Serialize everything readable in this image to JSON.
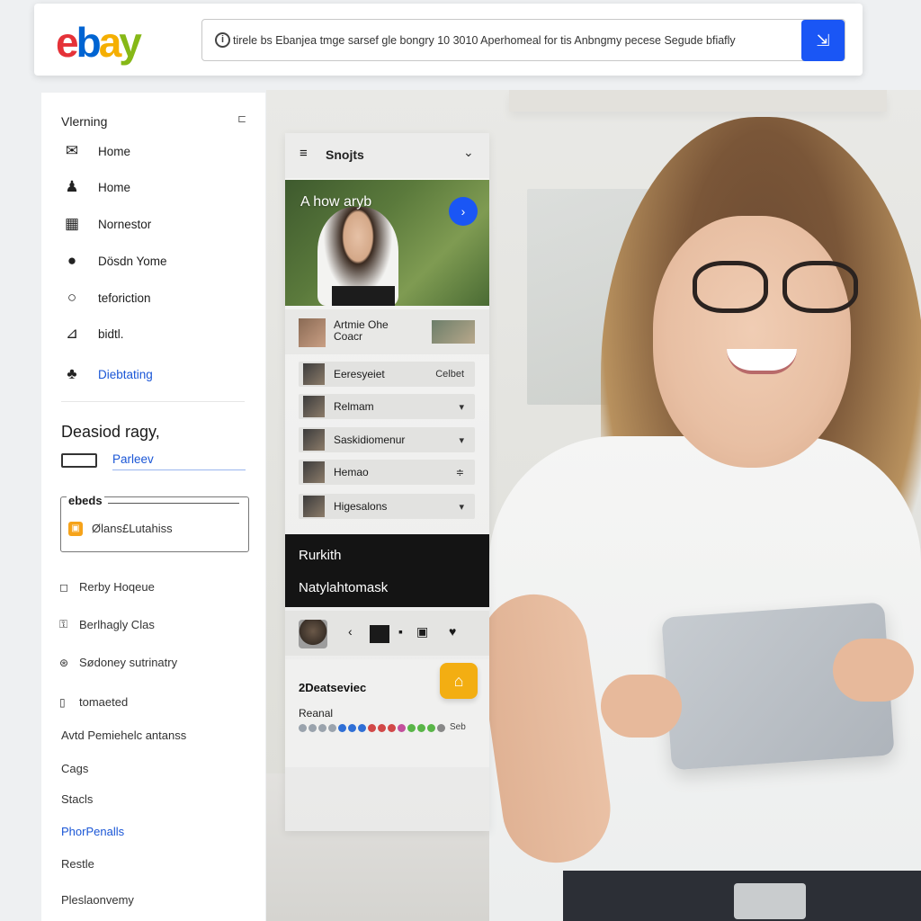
{
  "header": {
    "logo": {
      "e": "e",
      "b": "b",
      "a": "a",
      "y": "y"
    },
    "search": {
      "value": "tirele bs Ebanjea tmge sarsef gle bongry 10 3010 Aperhomeal for tis Anbngmy pecese Segude bfiafly"
    }
  },
  "sidebar": {
    "heading": "Vlerning",
    "items": [
      {
        "icon": "mail-icon",
        "label": "Home"
      },
      {
        "icon": "user-icon",
        "label": "Home"
      },
      {
        "icon": "grid-icon",
        "label": "Nornestor"
      },
      {
        "icon": "chat-icon",
        "label": "Dösdn Yome"
      },
      {
        "icon": "circle-icon",
        "label": "teforiction"
      },
      {
        "icon": "chart-icon",
        "label": "bidtl."
      },
      {
        "icon": "group-icon",
        "label": "Diebtating"
      }
    ],
    "section_title": "Deasiod ragy,",
    "section_link": "Parleev",
    "box": {
      "title": "ebeds",
      "text": "Ølans£Lutahiss"
    },
    "links": [
      {
        "label": "Rerby Hoqeue"
      },
      {
        "label": "Berlhagly Clas"
      },
      {
        "label": "Sødoney sutrinatry"
      },
      {
        "label": "tomaeted"
      }
    ],
    "plain": [
      {
        "label": "Avtd Pemiehelc antanss"
      },
      {
        "label": "Cags"
      },
      {
        "label": "Stacls"
      },
      {
        "label": "PhorPenalls"
      },
      {
        "label": "Restle"
      },
      {
        "label": "Pleslaonvemy"
      }
    ]
  },
  "panel": {
    "title": "Snojts",
    "hero_title": "A how aryb",
    "featured": {
      "line1": "Artmie Ohe",
      "line2": "Coacr"
    },
    "rows": [
      {
        "label": "Eeresyeiet",
        "right": "Celbet"
      },
      {
        "label": "Relmam",
        "right": "▾"
      },
      {
        "label": "Saskidiomenur",
        "right": "▾"
      },
      {
        "label": "Hemao",
        "right": "≑"
      },
      {
        "label": "Higesalons",
        "right": "▾"
      }
    ],
    "dark": {
      "line1": "Rurkith",
      "line2": "Natylahtomask"
    },
    "card": {
      "title": "2Deatseviec",
      "subtitle": "Reanal",
      "dots_label": "Seb"
    },
    "dot_colors": [
      "#9aa3ad",
      "#9aa3ad",
      "#9aa3ad",
      "#9aa3ad",
      "#2f6fd6",
      "#2f6fd6",
      "#2f6fd6",
      "#d14848",
      "#d14848",
      "#d14848",
      "#c24f9c",
      "#59b548",
      "#59b548",
      "#59b548",
      "#888888"
    ]
  }
}
